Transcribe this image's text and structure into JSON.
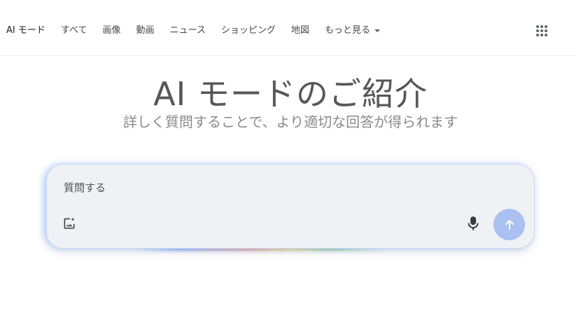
{
  "nav": {
    "tabs": [
      {
        "label": "AI モード",
        "active": true
      },
      {
        "label": "すべて"
      },
      {
        "label": "画像"
      },
      {
        "label": "動画"
      },
      {
        "label": "ニュース"
      },
      {
        "label": "ショッピング"
      },
      {
        "label": "地図"
      }
    ],
    "more_label": "もっと見る",
    "apps_icon": "apps-grid-icon"
  },
  "hero": {
    "title": "AI モードのご紹介",
    "subtitle": "詳しく質問することで、より適切な回答が得られます"
  },
  "search": {
    "placeholder": "質問する",
    "image_icon": "add-image-icon",
    "mic_icon": "mic-icon",
    "send_icon": "arrow-up-icon"
  },
  "colors": {
    "send_button": "#a9c0f0",
    "search_bg": "#f0f1f5",
    "glow_blue": "#4285f4",
    "glow_red": "#ea4335",
    "glow_yellow": "#fbbc05",
    "glow_green": "#34a853"
  }
}
